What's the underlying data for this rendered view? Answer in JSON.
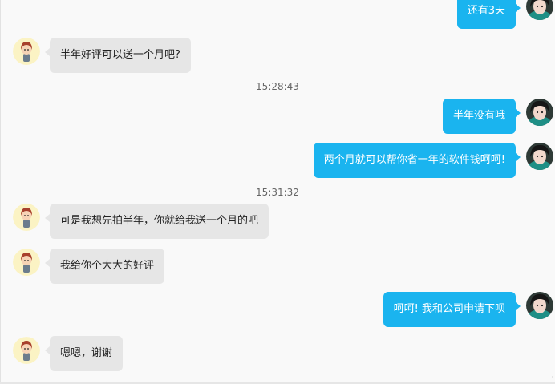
{
  "colors": {
    "outgoing_bubble": "#1ab4ef",
    "incoming_bubble": "#e6e6e6",
    "background": "#f9f9f9"
  },
  "avatars": {
    "customer": "cartoon-girl-avatar-icon",
    "seller": "girl-photo-avatar-icon"
  },
  "messages": [
    {
      "direction": "out",
      "text": "还有3天"
    },
    {
      "direction": "in",
      "text": "半年好评可以送一个月吧?"
    },
    {
      "type": "timestamp",
      "text": "15:28:43"
    },
    {
      "direction": "out",
      "text": "半年没有哦"
    },
    {
      "direction": "out",
      "text": "两个月就可以帮你省一年的软件钱呵呵!"
    },
    {
      "type": "timestamp",
      "text": "15:31:32"
    },
    {
      "direction": "in",
      "text": "可是我想先拍半年，你就给我送一个月的吧"
    },
    {
      "direction": "in",
      "text": "我给你个大大的好评"
    },
    {
      "direction": "out",
      "text": "呵呵! 我和公司申请下呗"
    },
    {
      "direction": "in",
      "text": "嗯嗯，谢谢"
    }
  ]
}
